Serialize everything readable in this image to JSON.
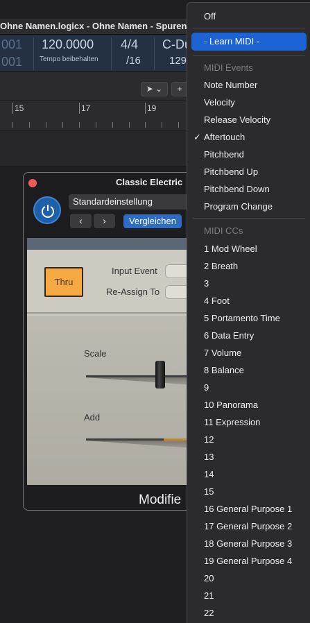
{
  "window": {
    "title": "Ohne Namen.logicx - Ohne Namen - Spuren"
  },
  "lcd": {
    "pos_top": "001",
    "pos_bottom": "001",
    "tempo": "120.0000",
    "tempo_mode": "Tempo beibehalten",
    "signature": "4/4",
    "division": "/16",
    "key": "C-Dur",
    "key_partial": "C-Du",
    "extra": "129"
  },
  "ruler": {
    "marks": [
      "15",
      "17",
      "19"
    ]
  },
  "plugin": {
    "title": "Classic Electric",
    "preset": "Standardeinstellung",
    "prev": "‹",
    "next": "›",
    "compare": "Vergleichen",
    "thru": "Thru",
    "input_event_label": "Input Event",
    "reassign_label": "Re-Assign To",
    "scale_label": "Scale",
    "add_label": "Add",
    "footer": "Modifier",
    "footer_visible": "Modifie",
    "scale_value": 0.5,
    "add_value": 0.5
  },
  "menu": {
    "off": "Off",
    "learn": "- Learn MIDI -",
    "events_header": "MIDI Events",
    "events": [
      "Note Number",
      "Velocity",
      "Release Velocity",
      "Aftertouch",
      "Pitchbend",
      "Pitchbend Up",
      "Pitchbend Down",
      "Program Change"
    ],
    "checked": "Aftertouch",
    "checkmark": "✓",
    "ccs_header": "MIDI CCs",
    "ccs": [
      "1 Mod Wheel",
      "2 Breath",
      "3",
      "4 Foot",
      "5 Portamento Time",
      "6 Data Entry",
      "7 Volume",
      "8 Balance",
      "9",
      "10 Panorama",
      "11 Expression",
      "12",
      "13",
      "14",
      "15",
      "16 General Purpose 1",
      "17 General Purpose 2",
      "18 General Purpose 3",
      "19 General Purpose 4",
      "20",
      "21",
      "22"
    ]
  },
  "colors": {
    "highlight": "#1c63d6",
    "thru": "#f4a942",
    "compare": "#2e6cc6"
  }
}
